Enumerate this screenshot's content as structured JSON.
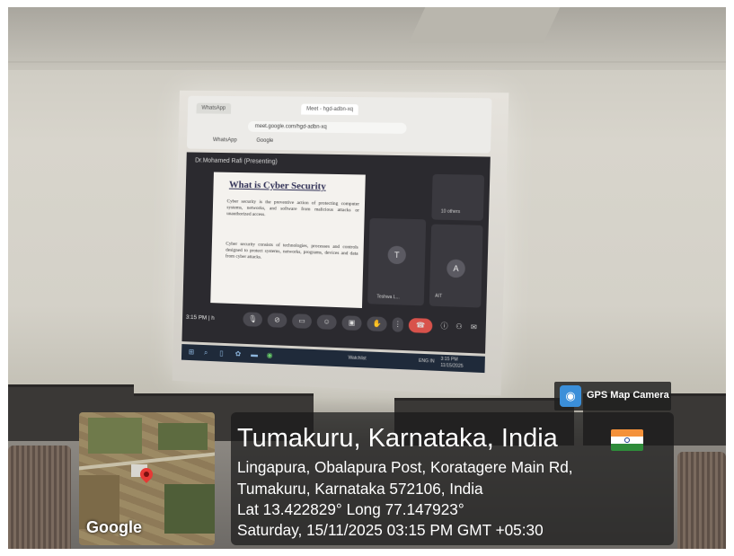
{
  "browser": {
    "tabs": [
      "WhatsApp",
      "Meet - hgd-adbn-xq"
    ],
    "url": "meet.google.com/hgd-adbn-xq",
    "bookmarks": [
      "WhatsApp",
      "Google"
    ]
  },
  "meet": {
    "presenter": "Dr.Mohamed Rafi (Presenting)",
    "clock": "3:15 PM  |  h",
    "participants": [
      {
        "initial": "T",
        "label": "Teshwa L..."
      },
      {
        "initial": "A",
        "label": "AIT"
      }
    ],
    "others_label": "10 others"
  },
  "slide": {
    "title": "What is Cyber Security",
    "bullet1": "Cyber security is the preventive action of protecting computer systems, networks, and software from malicious attacks or unauthorized access.",
    "bullet2": "Cyber security consists of technologies, processes and controls designed to protect systems, networks, programs, devices and data from cyber attacks."
  },
  "taskbar": {
    "watchlist": "Watchlist",
    "lang": "ENG IN",
    "time": "3:15 PM",
    "date": "11/15/2025"
  },
  "overlay": {
    "badge": "GPS Map Camera",
    "map_logo": "Google",
    "title": "Tumakuru, Karnataka, India",
    "address_line1": "Lingapura, Obalapura Post, Koratagere Main Rd,",
    "address_line2": "Tumakuru, Karnataka 572106, India",
    "coords": "Lat 13.422829° Long 77.147923°",
    "datetime": "Saturday, 15/11/2025 03:15 PM GMT +05:30"
  },
  "colors": {
    "flag_saffron": "#f4913a",
    "flag_green": "#2e8b3a",
    "pin": "#e53935",
    "badge_icon": "#3b8fd9"
  }
}
